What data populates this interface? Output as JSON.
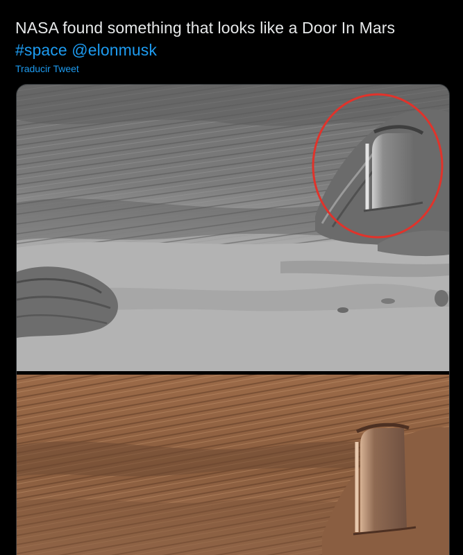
{
  "tweet": {
    "text_main": "NASA found something that looks like a Door In Mars",
    "hashtag": "#space",
    "mention": "@elonmusk",
    "translate_label": "Traducir Tweet"
  },
  "media": {
    "photo_count": 2,
    "top_photo_tone": "grayscale",
    "bottom_photo_tone": "color",
    "highlight_color": "#e0332b",
    "link_color": "#1d9bf0",
    "text_color": "#e7e9ea",
    "background_color": "#000000"
  }
}
